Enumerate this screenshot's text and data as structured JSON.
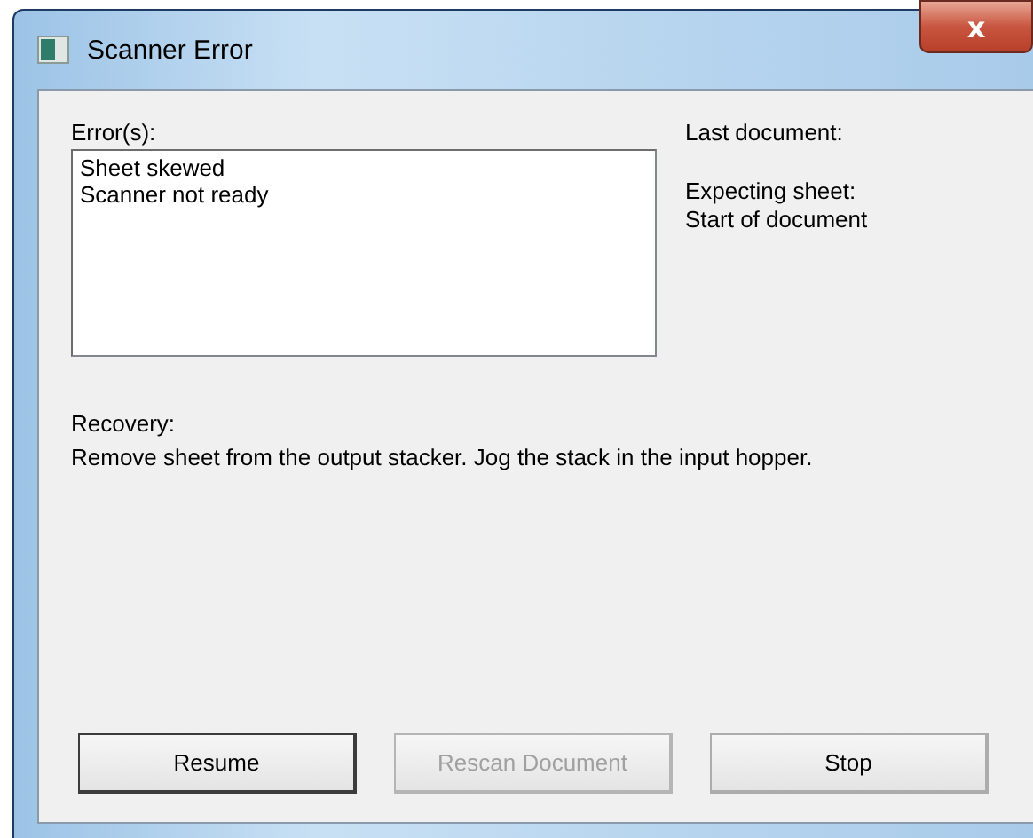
{
  "window": {
    "title": "Scanner Error",
    "close": "x"
  },
  "errors": {
    "label": "Error(s):",
    "items": [
      "Sheet skewed",
      "Scanner not ready"
    ]
  },
  "info": [
    {
      "label": "Last document:"
    },
    {
      "label": "Expecting sheet:",
      "value": "Start of document"
    }
  ],
  "recovery": {
    "label": "Recovery:",
    "text": "Remove sheet from the output stacker.  Jog the stack in the input hopper."
  },
  "buttons": [
    {
      "label": "Resume",
      "disabled": false,
      "default": true
    },
    {
      "label": "Rescan Document",
      "disabled": true,
      "default": false
    },
    {
      "label": "Stop",
      "disabled": false,
      "default": false
    }
  ]
}
